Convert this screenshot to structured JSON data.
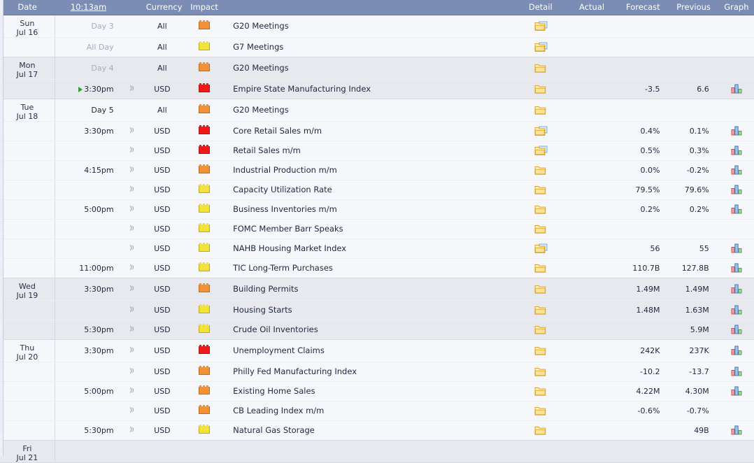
{
  "header": {
    "date": "Date",
    "time": "10:13am",
    "currency": "Currency",
    "impact": "Impact",
    "event": "",
    "detail": "Detail",
    "actual": "Actual",
    "forecast": "Forecast",
    "previous": "Previous",
    "graph": "Graph"
  },
  "colors": {
    "header_bg": "#7b8cb5",
    "impact_high": "#ef1919",
    "impact_medium": "#f29136",
    "impact_low": "#f2e23c",
    "row_shade": "#e7e9ef",
    "row_light": "#f6f7fa",
    "play_arrow": "#2f9e34"
  },
  "icons": {
    "sound": "sound-wave-icon",
    "folder": "folder-icon",
    "folder_detail": "folder-with-page-icon",
    "graph": "bar-graph-icon",
    "play": "green-play-arrow-icon"
  },
  "days": [
    {
      "name": "Sun",
      "date": "Jul 16"
    },
    {
      "name": "Mon",
      "date": "Jul 17"
    },
    {
      "name": "Tue",
      "date": "Jul 18"
    },
    {
      "name": "Wed",
      "date": "Jul 19"
    },
    {
      "name": "Thu",
      "date": "Jul 20"
    },
    {
      "name": "Fri",
      "date": "Jul 21"
    }
  ],
  "rows": [
    {
      "day_name": "Sun",
      "day_date": "Jul 16",
      "time": "Day 3",
      "time_muted": true,
      "play": false,
      "sound": false,
      "currency": "All",
      "impact": "orange",
      "event": "G20 Meetings",
      "detail": "detail",
      "actual": "",
      "forecast": "",
      "previous": "",
      "graph": false
    },
    {
      "day_name": "",
      "day_date": "",
      "time": "All Day",
      "time_muted": true,
      "play": false,
      "sound": false,
      "currency": "All",
      "impact": "yellow",
      "event": "G7 Meetings",
      "detail": "detail",
      "actual": "",
      "forecast": "",
      "previous": "",
      "graph": false
    },
    {
      "day_name": "Mon",
      "day_date": "Jul 17",
      "time": "Day 4",
      "time_muted": true,
      "play": false,
      "sound": false,
      "currency": "All",
      "impact": "orange",
      "event": "G20 Meetings",
      "detail": "folder",
      "actual": "",
      "forecast": "",
      "previous": "",
      "graph": false
    },
    {
      "day_name": "",
      "day_date": "",
      "time": "3:30pm",
      "time_muted": false,
      "play": true,
      "sound": true,
      "currency": "USD",
      "impact": "red",
      "event": "Empire State Manufacturing Index",
      "detail": "folder",
      "actual": "",
      "forecast": "-3.5",
      "previous": "6.6",
      "graph": true
    },
    {
      "day_name": "Tue",
      "day_date": "Jul 18",
      "time": "Day 5",
      "time_muted": false,
      "play": false,
      "sound": false,
      "currency": "All",
      "impact": "orange",
      "event": "G20 Meetings",
      "detail": "folder",
      "actual": "",
      "forecast": "",
      "previous": "",
      "graph": false
    },
    {
      "day_name": "",
      "day_date": "",
      "time": "3:30pm",
      "time_muted": false,
      "play": false,
      "sound": true,
      "currency": "USD",
      "impact": "red",
      "event": "Core Retail Sales m/m",
      "detail": "detail",
      "actual": "",
      "forecast": "0.4%",
      "previous": "0.1%",
      "graph": true
    },
    {
      "day_name": "",
      "day_date": "",
      "time": "",
      "time_muted": false,
      "play": false,
      "sound": true,
      "currency": "USD",
      "impact": "red",
      "event": "Retail Sales m/m",
      "detail": "detail",
      "actual": "",
      "forecast": "0.5%",
      "previous": "0.3%",
      "graph": true
    },
    {
      "day_name": "",
      "day_date": "",
      "time": "4:15pm",
      "time_muted": false,
      "play": false,
      "sound": true,
      "currency": "USD",
      "impact": "orange",
      "event": "Industrial Production m/m",
      "detail": "folder",
      "actual": "",
      "forecast": "0.0%",
      "previous": "-0.2%",
      "graph": true
    },
    {
      "day_name": "",
      "day_date": "",
      "time": "",
      "time_muted": false,
      "play": false,
      "sound": true,
      "currency": "USD",
      "impact": "yellow",
      "event": "Capacity Utilization Rate",
      "detail": "folder",
      "actual": "",
      "forecast": "79.5%",
      "previous": "79.6%",
      "graph": true
    },
    {
      "day_name": "",
      "day_date": "",
      "time": "5:00pm",
      "time_muted": false,
      "play": false,
      "sound": true,
      "currency": "USD",
      "impact": "yellow",
      "event": "Business Inventories m/m",
      "detail": "folder",
      "actual": "",
      "forecast": "0.2%",
      "previous": "0.2%",
      "graph": true
    },
    {
      "day_name": "",
      "day_date": "",
      "time": "",
      "time_muted": false,
      "play": false,
      "sound": true,
      "currency": "USD",
      "impact": "yellow",
      "event": "FOMC Member Barr Speaks",
      "detail": "folder",
      "actual": "",
      "forecast": "",
      "previous": "",
      "graph": false
    },
    {
      "day_name": "",
      "day_date": "",
      "time": "",
      "time_muted": false,
      "play": false,
      "sound": true,
      "currency": "USD",
      "impact": "yellow",
      "event": "NAHB Housing Market Index",
      "detail": "detail",
      "actual": "",
      "forecast": "56",
      "previous": "55",
      "graph": true
    },
    {
      "day_name": "",
      "day_date": "",
      "time": "11:00pm",
      "time_muted": false,
      "play": false,
      "sound": true,
      "currency": "USD",
      "impact": "yellow",
      "event": "TIC Long-Term Purchases",
      "detail": "folder",
      "actual": "",
      "forecast": "110.7B",
      "previous": "127.8B",
      "graph": true
    },
    {
      "day_name": "Wed",
      "day_date": "Jul 19",
      "time": "3:30pm",
      "time_muted": false,
      "play": false,
      "sound": true,
      "currency": "USD",
      "impact": "orange",
      "event": "Building Permits",
      "detail": "folder",
      "actual": "",
      "forecast": "1.49M",
      "previous": "1.49M",
      "graph": true
    },
    {
      "day_name": "",
      "day_date": "",
      "time": "",
      "time_muted": false,
      "play": false,
      "sound": true,
      "currency": "USD",
      "impact": "yellow",
      "event": "Housing Starts",
      "detail": "folder",
      "actual": "",
      "forecast": "1.48M",
      "previous": "1.63M",
      "graph": true
    },
    {
      "day_name": "",
      "day_date": "",
      "time": "5:30pm",
      "time_muted": false,
      "play": false,
      "sound": true,
      "currency": "USD",
      "impact": "yellow",
      "event": "Crude Oil Inventories",
      "detail": "folder",
      "actual": "",
      "forecast": "",
      "previous": "5.9M",
      "graph": true
    },
    {
      "day_name": "Thu",
      "day_date": "Jul 20",
      "time": "3:30pm",
      "time_muted": false,
      "play": false,
      "sound": true,
      "currency": "USD",
      "impact": "red",
      "event": "Unemployment Claims",
      "detail": "folder",
      "actual": "",
      "forecast": "242K",
      "previous": "237K",
      "graph": true
    },
    {
      "day_name": "",
      "day_date": "",
      "time": "",
      "time_muted": false,
      "play": false,
      "sound": true,
      "currency": "USD",
      "impact": "orange",
      "event": "Philly Fed Manufacturing Index",
      "detail": "folder",
      "actual": "",
      "forecast": "-10.2",
      "previous": "-13.7",
      "graph": true
    },
    {
      "day_name": "",
      "day_date": "",
      "time": "5:00pm",
      "time_muted": false,
      "play": false,
      "sound": true,
      "currency": "USD",
      "impact": "orange",
      "event": "Existing Home Sales",
      "detail": "folder",
      "actual": "",
      "forecast": "4.22M",
      "previous": "4.30M",
      "graph": true
    },
    {
      "day_name": "",
      "day_date": "",
      "time": "",
      "time_muted": false,
      "play": false,
      "sound": true,
      "currency": "USD",
      "impact": "orange",
      "event": "CB Leading Index m/m",
      "detail": "folder",
      "actual": "",
      "forecast": "-0.6%",
      "previous": "-0.7%",
      "graph": false
    },
    {
      "day_name": "",
      "day_date": "",
      "time": "5:30pm",
      "time_muted": false,
      "play": false,
      "sound": true,
      "currency": "USD",
      "impact": "yellow",
      "event": "Natural Gas Storage",
      "detail": "folder",
      "actual": "",
      "forecast": "",
      "previous": "49B",
      "graph": true
    },
    {
      "day_name": "Fri",
      "day_date": "Jul 21",
      "time": "",
      "time_muted": false,
      "play": false,
      "sound": false,
      "currency": "",
      "impact": "",
      "event": "",
      "detail": "",
      "actual": "",
      "forecast": "",
      "previous": "",
      "graph": false
    }
  ]
}
